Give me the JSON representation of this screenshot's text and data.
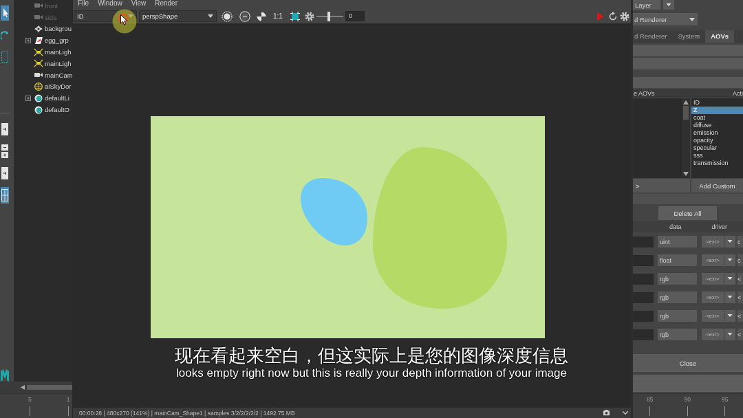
{
  "tool_strip": {
    "tools": [
      {
        "kind": "select",
        "selected": true
      },
      {
        "kind": "rotate",
        "selected": false
      },
      {
        "kind": "marquee",
        "selected": false
      }
    ],
    "layouts": [
      {
        "kind": "single",
        "selected": false
      },
      {
        "kind": "split",
        "selected": false
      },
      {
        "kind": "single",
        "selected": false
      },
      {
        "kind": "grid",
        "selected": true
      }
    ]
  },
  "outliner": {
    "items": [
      {
        "label": "front",
        "kind": "camera",
        "dimmed": true,
        "expandable": false
      },
      {
        "label": "side",
        "kind": "camera",
        "dimmed": true,
        "expandable": false
      },
      {
        "label": "backgrou",
        "kind": "plane",
        "dimmed": false,
        "expandable": false
      },
      {
        "label": "egg_grp",
        "kind": "group",
        "dimmed": false,
        "expandable": true
      },
      {
        "label": "mainLigh",
        "kind": "light",
        "dimmed": false,
        "expandable": false
      },
      {
        "label": "mainLigh",
        "kind": "light",
        "dimmed": false,
        "expandable": false
      },
      {
        "label": "mainCam",
        "kind": "camera",
        "dimmed": false,
        "expandable": false
      },
      {
        "label": "aiSkyDor",
        "kind": "sky",
        "dimmed": false,
        "expandable": false
      },
      {
        "label": "defaultLi",
        "kind": "set",
        "dimmed": false,
        "expandable": true
      },
      {
        "label": "defaultO",
        "kind": "set",
        "dimmed": false,
        "expandable": false
      }
    ]
  },
  "render_view": {
    "menu": [
      "File",
      "Window",
      "View",
      "Render"
    ],
    "aov_dropdown": "ID",
    "camera_dropdown": "perspShape",
    "zoom_ratio": "1:1",
    "exposure": {
      "level": 0.47,
      "value": "0"
    },
    "status": "00:00:28 | 480x270 (141%) | mainCam_Shape1 | samples 3/2/2/2/2/2 | 1492.75 MB"
  },
  "subtitles": [
    "现在看起来空白，但这实际上是您的图像深度信息",
    "looks empty right now but this is really your depth information of your image"
  ],
  "attribute_editor": {
    "layer_dropdown": "Layer",
    "renderer_dropdown": "d Renderer",
    "tabs": [
      {
        "label": "d Renderer",
        "selected": false
      },
      {
        "label": "System",
        "selected": false
      },
      {
        "label": "AOVs",
        "selected": true
      }
    ],
    "available_header": "e AOVs",
    "active_header": "Acti",
    "active_aovs": [
      {
        "label": "ID",
        "selected": false
      },
      {
        "label": "Z",
        "selected": true
      },
      {
        "label": "coat",
        "selected": false
      },
      {
        "label": "diffuse",
        "selected": false
      },
      {
        "label": "emission",
        "selected": false
      },
      {
        "label": "opacity",
        "selected": false
      },
      {
        "label": "specular",
        "selected": false
      },
      {
        "label": "sss",
        "selected": false
      },
      {
        "label": "transmission",
        "selected": false
      }
    ],
    "move_button": ">",
    "add_custom_button": "Add Custom",
    "delete_all_button": "Delete All",
    "columns": [
      "data",
      "driver"
    ],
    "aov_rows": [
      {
        "data": "uint",
        "driver": "<exr>",
        "column_3": "c"
      },
      {
        "data": "float",
        "driver": "<exr>",
        "column_3": "c"
      },
      {
        "data": "rgb",
        "driver": "<exr>",
        "column_3": "<"
      },
      {
        "data": "rgb",
        "driver": "<exr>",
        "column_3": "<"
      },
      {
        "data": "rgb",
        "driver": "<exr>",
        "column_3": "<"
      },
      {
        "data": "rgb",
        "driver": "<exr>",
        "column_3": "<"
      }
    ],
    "close_button": "Close"
  },
  "timeline": {
    "left_labels": [
      "5",
      "1"
    ],
    "right_labels": [
      "85",
      "90",
      "95"
    ]
  }
}
